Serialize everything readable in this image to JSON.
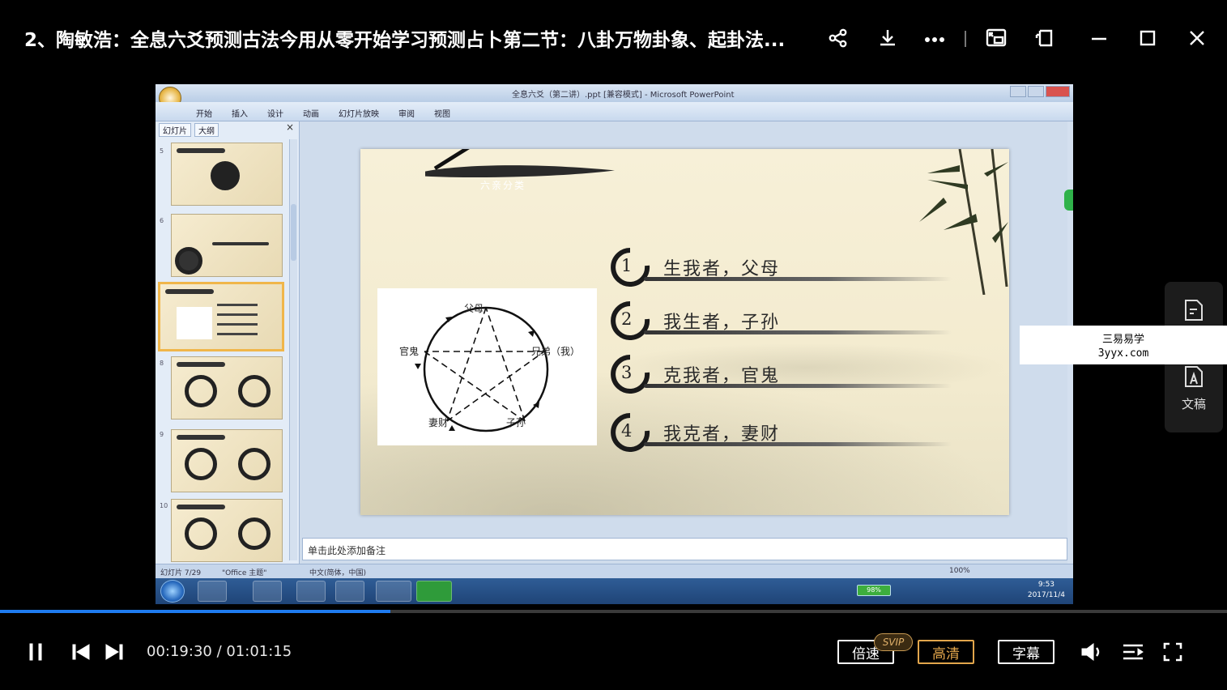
{
  "window": {
    "title": "2、陶敏浩：全息六爻预测古法今用从零开始学习预测占卜第二节：八卦万物卦象、起卦法...",
    "buttons": [
      "share-icon",
      "download-icon",
      "more-icon",
      "pip-icon",
      "mini-icon",
      "minimize-icon",
      "maximize-icon",
      "close-icon"
    ]
  },
  "ppt": {
    "window_title": "全息六爻（第二讲）.ppt [兼容模式] - Microsoft PowerPoint",
    "ribbon_tabs": [
      "开始",
      "插入",
      "设计",
      "动画",
      "幻灯片放映",
      "审阅",
      "视图"
    ],
    "panel_tabs": [
      "幻灯片",
      "大纲"
    ],
    "panel_close": "×",
    "thumbnails": [
      {
        "num": "5"
      },
      {
        "num": "6"
      },
      {
        "num": "7"
      },
      {
        "num": "8"
      },
      {
        "num": "9"
      },
      {
        "num": "10"
      }
    ],
    "notes_placeholder": "单击此处添加备注",
    "status": {
      "slide_count": "幻灯片 7/29",
      "theme": "\"Office 主题\"",
      "language": "中文(简体，中国)",
      "zoom": "100%"
    },
    "taskbar": {
      "battery": "98%",
      "time": "9:53",
      "date": "2017/11/4"
    }
  },
  "slide": {
    "banner": "六亲分类",
    "diagram": {
      "nodes": [
        "父母",
        "兄弟（我）",
        "子孙",
        "妻财",
        "官鬼"
      ]
    },
    "items": [
      {
        "num": "1",
        "text": "生我者，父母"
      },
      {
        "num": "2",
        "text": "我生者，子孙"
      },
      {
        "num": "3",
        "text": "克我者，官鬼"
      },
      {
        "num": "4",
        "text": "我克者，妻财"
      }
    ]
  },
  "side_panel": {
    "label": "文稿"
  },
  "watermark": {
    "line1": "三易易学",
    "line2": "3yyx.com"
  },
  "player": {
    "time": "00:19:30 / 01:01:15",
    "progress_fraction": 0.3184,
    "speed_label": "倍速",
    "svip_badge": "SVIP",
    "quality_label": "高清",
    "subtitle_label": "字幕"
  }
}
